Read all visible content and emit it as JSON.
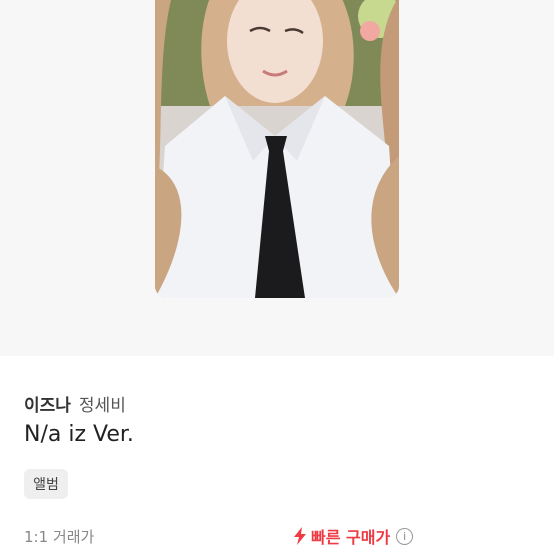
{
  "product": {
    "artist": "이즈나",
    "member": "정세비",
    "title": "N/a iz Ver.",
    "tag": "앨범"
  },
  "pricing": {
    "trade_label": "1:1 거래가",
    "fast_buy_label": "빠른 구매가",
    "info_glyph": "i"
  },
  "colors": {
    "accent": "#ee3b43",
    "tag_bg": "#efefef",
    "image_bg": "#f7f7f7"
  },
  "icons": {
    "fast_buy": "lightning-bolt-icon",
    "info": "info-circle-icon"
  }
}
